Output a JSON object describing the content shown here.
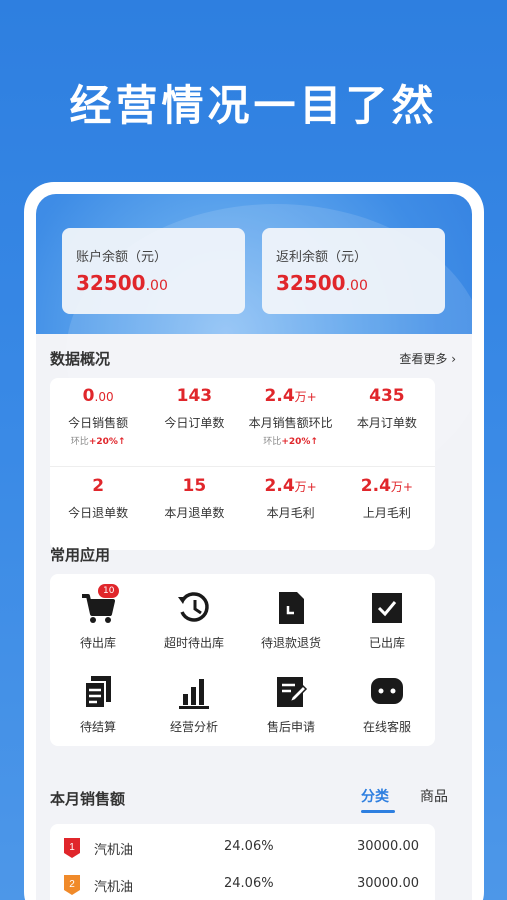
{
  "headline": "经营情况一目了然",
  "balances": [
    {
      "label": "账户余额（元）",
      "value_int": "32500",
      "value_dec": ".00"
    },
    {
      "label": "返利余额（元）",
      "value_int": "32500",
      "value_dec": ".00"
    }
  ],
  "overview": {
    "title": "数据概况",
    "more": "查看更多",
    "row1": [
      {
        "value": "0",
        "suffix": ".00",
        "label": "今日销售额",
        "sub_prefix": "环比",
        "sub_value": "+20%"
      },
      {
        "value": "143",
        "suffix": "",
        "label": "今日订单数",
        "sub_prefix": "",
        "sub_value": ""
      },
      {
        "value": "2.4",
        "suffix": "万+",
        "label": "本月销售额环比",
        "sub_prefix": "环比",
        "sub_value": "+20%"
      },
      {
        "value": "435",
        "suffix": "",
        "label": "本月订单数",
        "sub_prefix": "",
        "sub_value": ""
      }
    ],
    "row2": [
      {
        "value": "2",
        "suffix": "",
        "label": "今日退单数"
      },
      {
        "value": "15",
        "suffix": "",
        "label": "本月退单数"
      },
      {
        "value": "2.4",
        "suffix": "万+",
        "label": "本月毛利"
      },
      {
        "value": "2.4",
        "suffix": "万+",
        "label": "上月毛利"
      }
    ]
  },
  "apps": {
    "title": "常用应用",
    "items": [
      {
        "label": "待出库",
        "icon": "cart-icon",
        "badge": "10"
      },
      {
        "label": "超时待出库",
        "icon": "history-icon"
      },
      {
        "label": "待退款退货",
        "icon": "document-icon"
      },
      {
        "label": "已出库",
        "icon": "checkbox-icon"
      },
      {
        "label": "待结算",
        "icon": "files-icon"
      },
      {
        "label": "经营分析",
        "icon": "bar-chart-icon"
      },
      {
        "label": "售后申请",
        "icon": "edit-form-icon"
      },
      {
        "label": "在线客服",
        "icon": "chat-icon"
      }
    ]
  },
  "sales": {
    "title": "本月销售额",
    "tabs": [
      "分类",
      "商品"
    ],
    "active_tab": "分类",
    "rows": [
      {
        "rank": "1",
        "name": "汽机油",
        "pct": "24.06%",
        "amount": "30000.00",
        "color": "#e0262b"
      },
      {
        "rank": "2",
        "name": "汽机油",
        "pct": "24.06%",
        "amount": "30000.00",
        "color": "#f08a2a"
      }
    ]
  },
  "colors": {
    "accent": "#2e7fe0",
    "value_red": "#e0262b"
  }
}
